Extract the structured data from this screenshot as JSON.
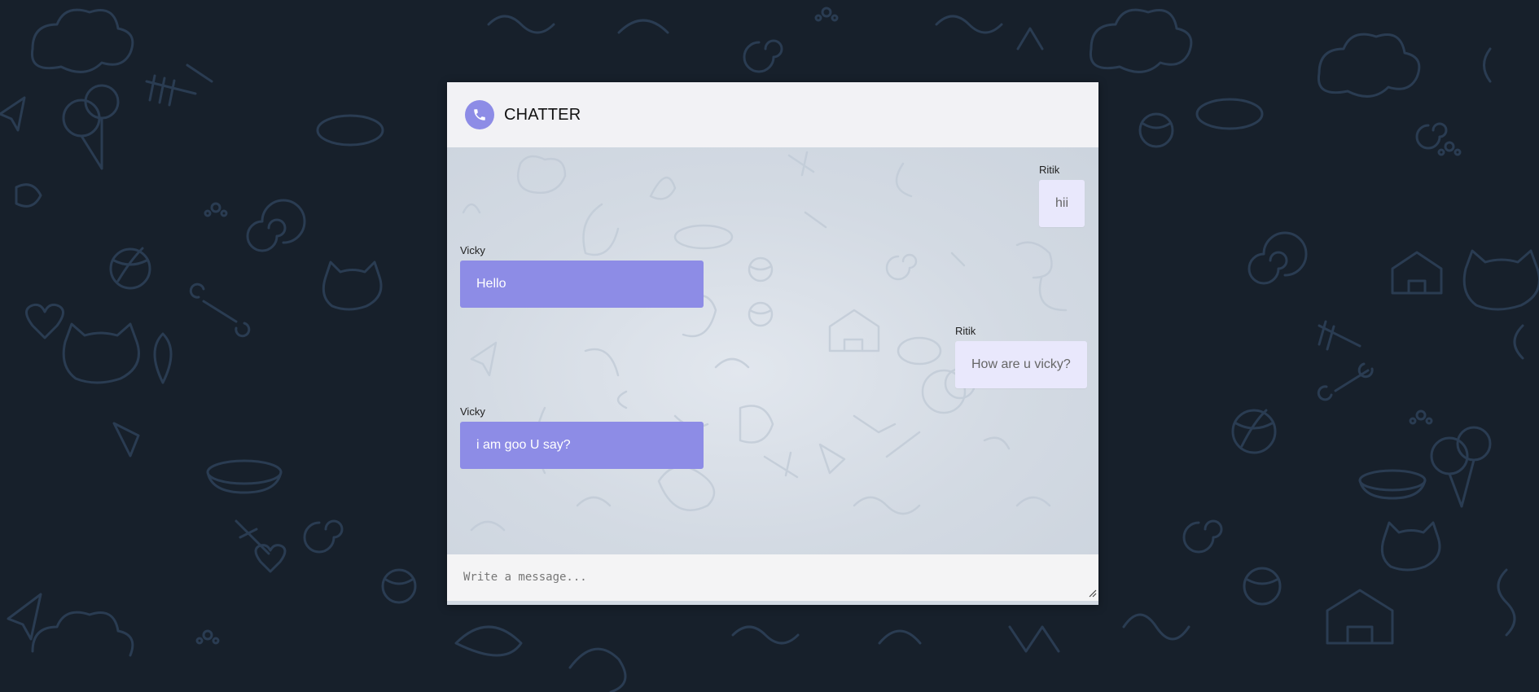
{
  "app": {
    "title": "CHATTER"
  },
  "icons": {
    "call": "phone-icon",
    "resize": "resize-grip-icon"
  },
  "colors": {
    "page_background": "#17202b",
    "pattern_stroke": "#2a3c52",
    "header_background": "#f2f2f5",
    "incoming_bubble": "#8d8ce6",
    "outgoing_bubble": "#e9e8fc",
    "accent": "#8d8ce6"
  },
  "messages": [
    {
      "sender": "Ritik",
      "text": "hii",
      "side": "right"
    },
    {
      "sender": "Vicky",
      "text": "Hello",
      "side": "left"
    },
    {
      "sender": "Ritik",
      "text": "How are u vicky?",
      "side": "right"
    },
    {
      "sender": "Vicky",
      "text": "i am goo U say?",
      "side": "left"
    }
  ],
  "composer": {
    "placeholder": "Write a message...",
    "value": ""
  }
}
